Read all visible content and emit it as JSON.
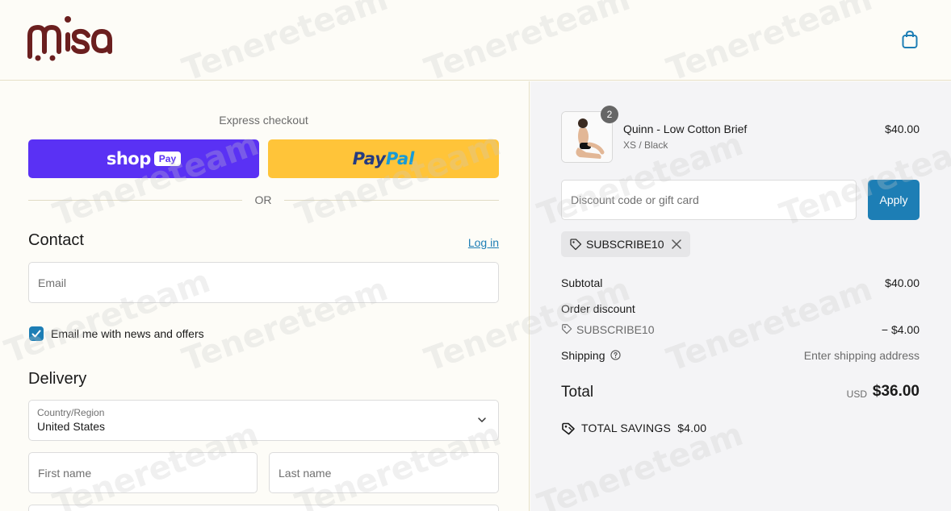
{
  "brand": {
    "logo_text": "misa",
    "brand_color": "#6b1f1f"
  },
  "header": {
    "cart_icon": "shopping-bag-icon"
  },
  "express": {
    "label": "Express checkout",
    "shop_pay_text": "shop",
    "shop_pay_pill": "Pay",
    "paypal_part1": "Pay",
    "paypal_part2": "Pal",
    "or_text": "OR"
  },
  "contact": {
    "heading": "Contact",
    "login_text": "Log in",
    "email_placeholder": "Email",
    "newsletter_label": "Email me with news and offers",
    "newsletter_checked": true
  },
  "delivery": {
    "heading": "Delivery",
    "country_label": "Country/Region",
    "country_value": "United States",
    "first_name_placeholder": "First name",
    "last_name_placeholder": "Last name"
  },
  "order": {
    "item": {
      "name": "Quinn - Low Cotton Brief",
      "variant": "XS / Black",
      "price": "$40.00",
      "quantity": "2"
    },
    "discount_placeholder": "Discount code or gift card",
    "apply_label": "Apply",
    "applied_code": "SUBSCRIBE10",
    "subtotal_label": "Subtotal",
    "subtotal_value": "$40.00",
    "order_discount_label": "Order discount",
    "discount_code": "SUBSCRIBE10",
    "discount_value": "− $4.00",
    "shipping_label": "Shipping",
    "shipping_value": "Enter shipping address",
    "total_label": "Total",
    "total_currency": "USD",
    "total_value": "$36.00",
    "savings_label": "TOTAL SAVINGS",
    "savings_value": "$4.00"
  },
  "colors": {
    "accent": "#1d7eb5",
    "shop_pay": "#5a31f4",
    "paypal": "#ffc439",
    "page_bg": "#fdfcf7",
    "summary_bg": "#f4f4f6"
  },
  "watermark": "Tenereteam"
}
